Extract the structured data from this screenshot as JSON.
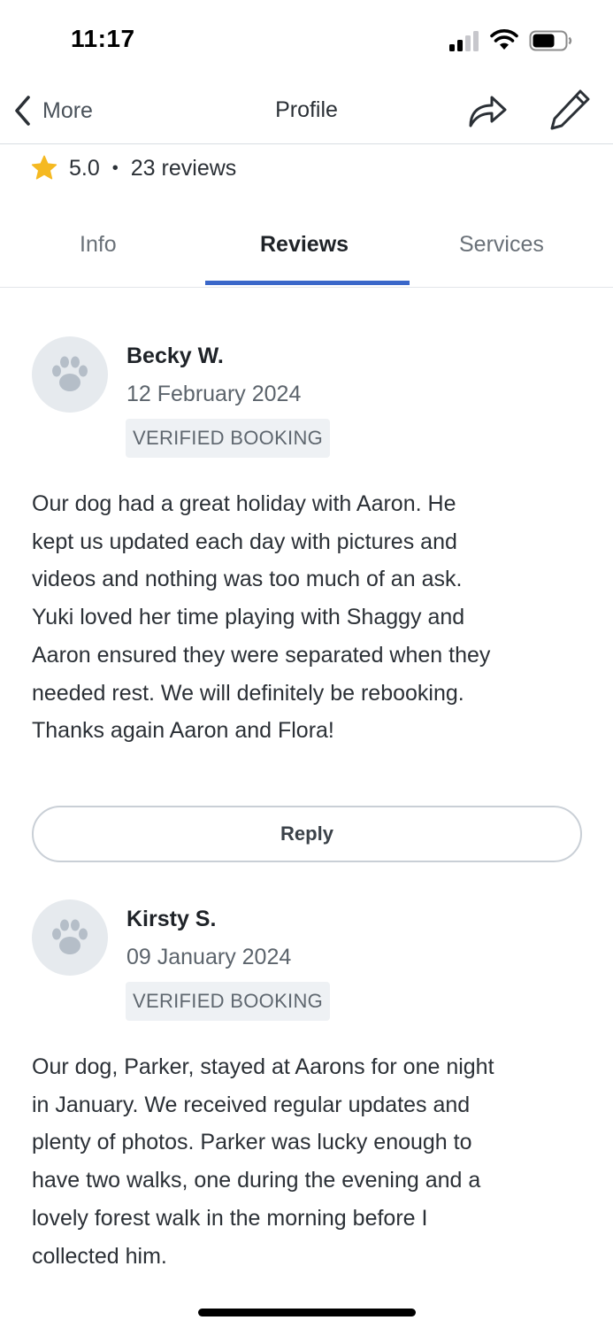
{
  "status_bar": {
    "time": "11:17"
  },
  "nav": {
    "back_label": "More",
    "title": "Profile"
  },
  "rating": {
    "score": "5.0",
    "separator": "•",
    "count": "23 reviews"
  },
  "tabs": [
    {
      "label": "Info",
      "active": false
    },
    {
      "label": "Reviews",
      "active": true
    },
    {
      "label": "Services",
      "active": false
    }
  ],
  "reviews": [
    {
      "name": "Becky W.",
      "date": "12 February 2024",
      "badge": "VERIFIED BOOKING",
      "lines": [
        "Our dog had a great holiday with Aaron. He",
        "kept us updated each day with pictures and",
        "videos and nothing was too much of an ask.",
        "Yuki loved her time playing with Shaggy and",
        "Aaron ensured they were separated when they",
        "needed rest. We will definitely be rebooking.",
        "Thanks again Aaron and Flora!"
      ],
      "reply_label": "Reply"
    },
    {
      "name": "Kirsty S.",
      "date": "09 January 2024",
      "badge": "VERIFIED BOOKING",
      "lines": [
        "Our dog, Parker, stayed at Aarons for one night",
        "in January. We received regular updates and",
        "plenty of photos. Parker was lucky enough to",
        "have two walks, one during the evening and a",
        "lovely forest walk in the morning before I",
        "collected him."
      ]
    }
  ],
  "colors": {
    "accent": "#3a67c9",
    "star": "#f5b921",
    "avatar_bg": "#e6eaee",
    "paw": "#b5bec8"
  },
  "icons": [
    "signal-icon",
    "wifi-icon",
    "battery-icon",
    "back-chevron-icon",
    "share-icon",
    "edit-icon",
    "star-icon",
    "paw-icon"
  ]
}
